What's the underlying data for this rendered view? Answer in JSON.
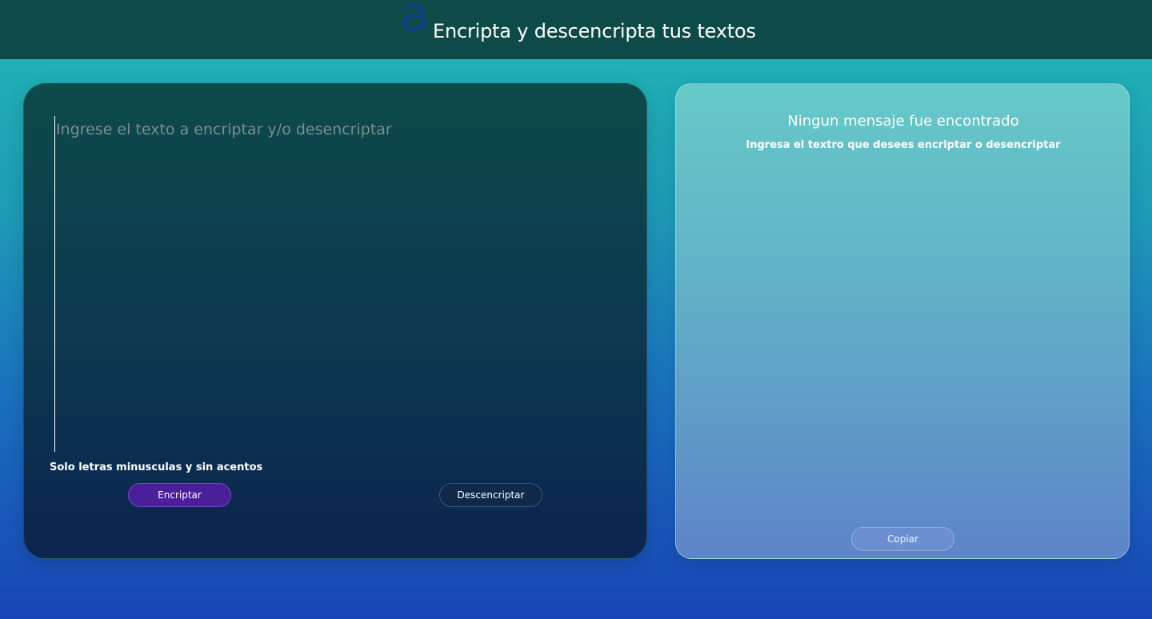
{
  "header": {
    "logo": "a",
    "title": "Encripta y descencripta tus textos"
  },
  "input_panel": {
    "placeholder": "Ingrese el texto a encriptar y/o desencriptar",
    "value": "",
    "hint": "Solo letras minusculas y sin acentos",
    "encrypt_label": "Encriptar",
    "decrypt_label": "Descencriptar"
  },
  "output_panel": {
    "empty_title": "Ningun mensaje fue encontrado",
    "empty_subtitle": "Ingresa el textro que desees encriptar o desencriptar",
    "copy_label": "Copiar"
  },
  "colors": {
    "header_bg": "#0e4b48",
    "encrypt_button": "#4a1f9a",
    "logo": "#0f3f82"
  }
}
